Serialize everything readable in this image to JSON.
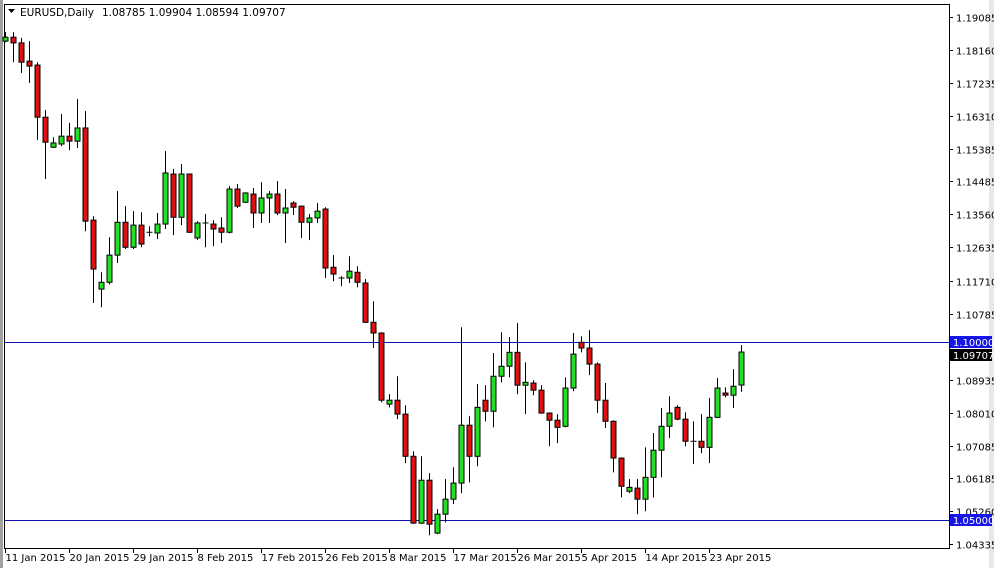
{
  "header": {
    "symbol": "EURUSD,Daily",
    "ohlc": "1.08785 1.09904 1.08594 1.09707"
  },
  "colors": {
    "bull": "#22e022",
    "bear": "#dd1111",
    "hline": "#1010b0",
    "tag_blue": "#1515e8",
    "tag_current": "#000000"
  },
  "chart_data": {
    "type": "candlestick",
    "title": "EURUSD,Daily",
    "ylim": [
      1.04335,
      1.19085
    ],
    "yticks": [
      "1.19085",
      "1.18160",
      "1.17235",
      "1.16310",
      "1.15385",
      "1.14485",
      "1.13560",
      "1.12635",
      "1.11710",
      "1.10785",
      "1.08935",
      "1.08010",
      "1.07085",
      "1.06185",
      "1.05260",
      "1.04335"
    ],
    "xlabels": [
      "11 Jan 2015",
      "20 Jan 2015",
      "29 Jan 2015",
      "8 Feb 2015",
      "17 Feb 2015",
      "26 Feb 2015",
      "8 Mar 2015",
      "17 Mar 2015",
      "26 Mar 2015",
      "5 Apr 2015",
      "14 Apr 2015",
      "23 Apr 2015"
    ],
    "xlabel_every_bars": 8,
    "hlines": [
      {
        "price": 1.1,
        "label": "1.10000"
      },
      {
        "price": 1.05,
        "label": "1.05000"
      }
    ],
    "current_price": {
      "price": 1.09707,
      "label": "1.09707"
    },
    "ohlc": [
      [
        1.1841,
        1.1866,
        1.1838,
        1.1852
      ],
      [
        1.1852,
        1.1866,
        1.1782,
        1.1836
      ],
      [
        1.1836,
        1.185,
        1.1752,
        1.1782
      ],
      [
        1.1785,
        1.1841,
        1.1724,
        1.1771
      ],
      [
        1.1774,
        1.1782,
        1.1564,
        1.1628
      ],
      [
        1.1628,
        1.1648,
        1.1455,
        1.1558
      ],
      [
        1.1544,
        1.1572,
        1.1542,
        1.1556
      ],
      [
        1.1553,
        1.1637,
        1.1547,
        1.1575
      ],
      [
        1.1575,
        1.1612,
        1.1536,
        1.1561
      ],
      [
        1.1561,
        1.1679,
        1.1542,
        1.1598
      ],
      [
        1.1598,
        1.1645,
        1.1309,
        1.1337
      ],
      [
        1.134,
        1.1351,
        1.1108,
        1.1203
      ],
      [
        1.1147,
        1.1194,
        1.1096,
        1.1166
      ],
      [
        1.1166,
        1.1292,
        1.116,
        1.1242
      ],
      [
        1.1242,
        1.1421,
        1.122,
        1.1334
      ],
      [
        1.1334,
        1.1379,
        1.1259,
        1.1264
      ],
      [
        1.1264,
        1.1365,
        1.1259,
        1.1326
      ],
      [
        1.1326,
        1.1362,
        1.1264,
        1.1273
      ],
      [
        1.1306,
        1.1323,
        1.1295,
        1.1305
      ],
      [
        1.1304,
        1.136,
        1.1287,
        1.1329
      ],
      [
        1.1329,
        1.1533,
        1.1315,
        1.1472
      ],
      [
        1.1469,
        1.1483,
        1.1298,
        1.1348
      ],
      [
        1.1348,
        1.1497,
        1.1326,
        1.1469
      ],
      [
        1.1469,
        1.147,
        1.1304,
        1.1306
      ],
      [
        1.129,
        1.1337,
        1.1284,
        1.1332
      ],
      [
        1.1332,
        1.1357,
        1.1264,
        1.1329
      ],
      [
        1.1329,
        1.134,
        1.1267,
        1.1315
      ],
      [
        1.1318,
        1.1348,
        1.1276,
        1.1306
      ],
      [
        1.1306,
        1.1435,
        1.1303,
        1.1427
      ],
      [
        1.1427,
        1.1441,
        1.1374,
        1.1379
      ],
      [
        1.139,
        1.1418,
        1.1388,
        1.1416
      ],
      [
        1.1413,
        1.143,
        1.1318,
        1.136
      ],
      [
        1.136,
        1.1446,
        1.1332,
        1.1402
      ],
      [
        1.1402,
        1.1421,
        1.1332,
        1.1413
      ],
      [
        1.1413,
        1.1449,
        1.1354,
        1.136
      ],
      [
        1.136,
        1.1427,
        1.1276,
        1.1374
      ],
      [
        1.1388,
        1.1393,
        1.1354,
        1.1376
      ],
      [
        1.1379,
        1.1381,
        1.129,
        1.1334
      ],
      [
        1.1334,
        1.1357,
        1.1284,
        1.1346
      ],
      [
        1.1346,
        1.1388,
        1.1332,
        1.1365
      ],
      [
        1.1371,
        1.1376,
        1.1178,
        1.1206
      ],
      [
        1.1208,
        1.1242,
        1.1169,
        1.1189
      ],
      [
        1.1178,
        1.1183,
        1.1155,
        1.1177
      ],
      [
        1.1178,
        1.1239,
        1.1164,
        1.1197
      ],
      [
        1.1194,
        1.1211,
        1.1152,
        1.1166
      ],
      [
        1.1164,
        1.1175,
        1.1052,
        1.1054
      ],
      [
        1.1054,
        1.1113,
        1.0982,
        1.1024
      ],
      [
        1.1024,
        1.1026,
        1.083,
        1.0836
      ],
      [
        1.0825,
        1.0853,
        1.0816,
        1.0836
      ],
      [
        1.0836,
        1.0903,
        1.0783,
        1.0797
      ],
      [
        1.0797,
        1.0822,
        1.066,
        1.0679
      ],
      [
        1.0679,
        1.0693,
        1.049,
        1.0492
      ],
      [
        1.0492,
        1.0679,
        1.049,
        1.0612
      ],
      [
        1.0612,
        1.0632,
        1.0458,
        1.0489
      ],
      [
        1.0464,
        1.0531,
        1.0461,
        1.0517
      ],
      [
        1.0517,
        1.0615,
        1.0494,
        1.0559
      ],
      [
        1.0559,
        1.0648,
        1.0545,
        1.0604
      ],
      [
        1.0604,
        1.104,
        1.0576,
        1.0766
      ],
      [
        1.0766,
        1.0791,
        1.0606,
        1.0679
      ],
      [
        1.0679,
        1.0881,
        1.0651,
        1.0816
      ],
      [
        1.0836,
        1.0878,
        1.0777,
        1.0805
      ],
      [
        1.0805,
        1.0968,
        1.076,
        1.0903
      ],
      [
        1.0903,
        1.1026,
        1.0886,
        1.0931
      ],
      [
        1.0931,
        1.1012,
        1.09,
        1.097
      ],
      [
        1.097,
        1.1052,
        1.0853,
        1.0878
      ],
      [
        1.0878,
        1.0942,
        1.0797,
        1.0886
      ],
      [
        1.0884,
        1.0892,
        1.085,
        1.0864
      ],
      [
        1.0864,
        1.0878,
        1.0798,
        1.08
      ],
      [
        1.08,
        1.0802,
        1.0707,
        1.078
      ],
      [
        1.078,
        1.0797,
        1.0716,
        1.076
      ],
      [
        1.0763,
        1.09,
        1.076,
        1.087
      ],
      [
        1.087,
        1.1024,
        1.0861,
        1.0965
      ],
      [
        1.0998,
        1.1015,
        1.097,
        1.0982
      ],
      [
        1.0982,
        1.1032,
        1.0906,
        1.0937
      ],
      [
        1.0937,
        1.0942,
        1.08,
        1.0836
      ],
      [
        1.0836,
        1.0884,
        1.0758,
        1.0777
      ],
      [
        1.0777,
        1.078,
        1.0634,
        1.0674
      ],
      [
        1.0674,
        1.0676,
        1.0564,
        1.0595
      ],
      [
        1.0581,
        1.0615,
        1.0576,
        1.0592
      ],
      [
        1.059,
        1.0615,
        1.0517,
        1.0559
      ],
      [
        1.0559,
        1.0704,
        1.0525,
        1.062
      ],
      [
        1.062,
        1.0744,
        1.0564,
        1.0696
      ],
      [
        1.0696,
        1.0814,
        1.062,
        1.0763
      ],
      [
        1.0763,
        1.0847,
        1.073,
        1.08
      ],
      [
        1.0816,
        1.0822,
        1.078,
        1.0783
      ],
      [
        1.0783,
        1.0802,
        1.0707,
        1.0721
      ],
      [
        1.0721,
        1.0777,
        1.0657,
        1.072
      ],
      [
        1.0721,
        1.0797,
        1.0688,
        1.0704
      ],
      [
        1.0704,
        1.0842,
        1.066,
        1.0788
      ],
      [
        1.0788,
        1.0898,
        1.0786,
        1.087
      ],
      [
        1.0856,
        1.0872,
        1.0844,
        1.085
      ],
      [
        1.085,
        1.0923,
        1.0814,
        1.0875
      ],
      [
        1.08785,
        1.09904,
        1.08594,
        1.09707
      ]
    ]
  }
}
